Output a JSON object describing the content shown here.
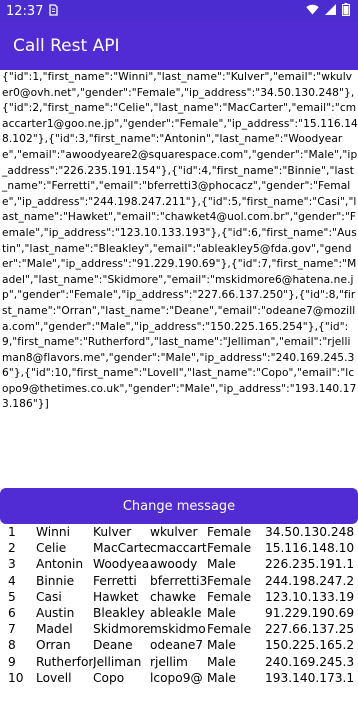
{
  "status_bar": {
    "time": "12:37",
    "sim_icon": "sim-icon",
    "icons": [
      "wifi-icon",
      "signal-icon",
      "battery-icon"
    ]
  },
  "app_bar": {
    "title": "Call Rest API"
  },
  "response_text": "{\"id\":1,\"first_name\":\"Winni\",\"last_name\":\"Kulver\",\"email\":\"wkulver0@ovh.net\",\"gender\":\"Female\",\"ip_address\":\"34.50.130.248\"},{\"id\":2,\"first_name\":\"Celie\",\"last_name\":\"MacCarter\",\"email\":\"cmaccarter1@goo.ne.jp\",\"gender\":\"Female\",\"ip_address\":\"15.116.148.102\"},{\"id\":3,\"first_name\":\"Antonin\",\"last_name\":\"Woodyeare\",\"email\":\"awoodyeare2@squarespace.com\",\"gender\":\"Male\",\"ip_address\":\"226.235.191.154\"},{\"id\":4,\"first_name\":\"Binnie\",\"last_name\":\"Ferretti\",\"email\":\"bferretti3@phocacz\",\"gender\":\"Female\",\"ip_address\":\"244.198.247.211\"},{\"id\":5,\"first_name\":\"Casi\",\"last_name\":\"Hawket\",\"email\":\"chawket4@uol.com.br\",\"gender\":\"Female\",\"ip_address\":\"123.10.133.193\"},{\"id\":6,\"first_name\":\"Austin\",\"last_name\":\"Bleakley\",\"email\":\"ableakley5@fda.gov\",\"gender\":\"Male\",\"ip_address\":\"91.229.190.69\"},{\"id\":7,\"first_name\":\"Madel\",\"last_name\":\"Skidmore\",\"email\":\"mskidmore6@hatena.ne.jp\",\"gender\":\"Female\",\"ip_address\":\"227.66.137.250\"},{\"id\":8,\"first_name\":\"Orran\",\"last_name\":\"Deane\",\"email\":\"odeane7@mozilla.com\",\"gender\":\"Male\",\"ip_address\":\"150.225.165.254\"},{\"id\":9,\"first_name\":\"Rutherford\",\"last_name\":\"Jelliman\",\"email\":\"rjelliman8@flavors.me\",\"gender\":\"Male\",\"ip_address\":\"240.169.245.36\"},{\"id\":10,\"first_name\":\"Lovell\",\"last_name\":\"Copo\",\"email\":\"lcopo9@thetimes.co.uk\",\"gender\":\"Male\",\"ip_address\":\"193.140.173.186\"}]",
  "button": {
    "label": "Change message"
  },
  "rows": [
    {
      "id": "1",
      "first": "Winni",
      "last": "Kulver",
      "email": "wkulver",
      "gender": "Female",
      "ip": "34.50.130.248"
    },
    {
      "id": "2",
      "first": "Celie",
      "last": "MacCarte",
      "email": "cmaccart",
      "gender": "Female",
      "ip": "15.116.148.10"
    },
    {
      "id": "3",
      "first": "Antonin",
      "last": "Woodyea",
      "email": "awoody",
      "gender": "Male",
      "ip": "226.235.191.1"
    },
    {
      "id": "4",
      "first": "Binnie",
      "last": "Ferretti",
      "email": "bferretti3",
      "gender": "Female",
      "ip": "244.198.247.2"
    },
    {
      "id": "5",
      "first": "Casi",
      "last": "Hawket",
      "email": "chawke",
      "gender": "Female",
      "ip": "123.10.133.19"
    },
    {
      "id": "6",
      "first": "Austin",
      "last": "Bleakley",
      "email": "ableakle",
      "gender": "Male",
      "ip": "91.229.190.69"
    },
    {
      "id": "7",
      "first": "Madel",
      "last": "Skidmore",
      "email": "mskidmo",
      "gender": "Female",
      "ip": "227.66.137.25"
    },
    {
      "id": "8",
      "first": "Orran",
      "last": "Deane",
      "email": "odeane7",
      "gender": "Male",
      "ip": "150.225.165.2"
    },
    {
      "id": "9",
      "first": "Rutherfor",
      "last": "Jelliman",
      "email": "rjellim",
      "gender": "Male",
      "ip": "240.169.245.3"
    },
    {
      "id": "10",
      "first": "Lovell",
      "last": "Copo",
      "email": "lcopo9@",
      "gender": "Male",
      "ip": "193.140.173.1"
    }
  ]
}
